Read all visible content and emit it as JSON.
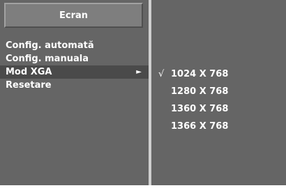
{
  "colors": {
    "panel_bg": "#656565",
    "title_bg": "#7e7e7e",
    "selected_bg": "#4a4a4a",
    "divider": "#cfcfcf",
    "text": "#ffffff"
  },
  "menu": {
    "title": "Ecran",
    "items": [
      {
        "label": "Config. automată",
        "selected": false
      },
      {
        "label": "Config. manuala",
        "selected": false
      },
      {
        "label": "Mod XGA",
        "selected": true,
        "submenu_arrow": "►"
      },
      {
        "label": "Resetare",
        "selected": false
      }
    ]
  },
  "submenu": {
    "check_mark": "√",
    "options": [
      {
        "label": "1024 X 768",
        "checked": true
      },
      {
        "label": "1280 X 768",
        "checked": false
      },
      {
        "label": "1360 X 768",
        "checked": false
      },
      {
        "label": "1366 X 768",
        "checked": false
      }
    ]
  }
}
